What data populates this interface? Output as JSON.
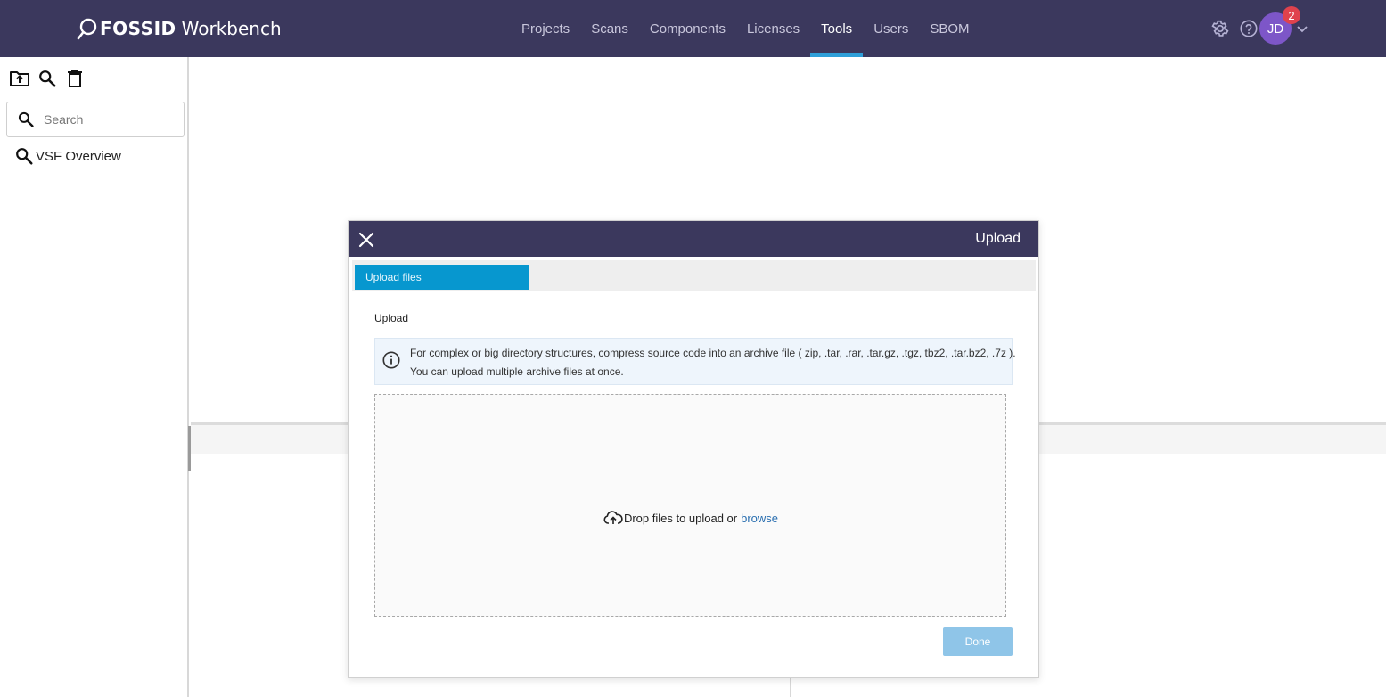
{
  "header": {
    "logo_brand": "FOSSID",
    "logo_product": "Workbench",
    "nav": [
      {
        "label": "Projects",
        "active": false
      },
      {
        "label": "Scans",
        "active": false
      },
      {
        "label": "Components",
        "active": false
      },
      {
        "label": "Licenses",
        "active": false
      },
      {
        "label": "Tools",
        "active": true
      },
      {
        "label": "Users",
        "active": false
      },
      {
        "label": "SBOM",
        "active": false
      }
    ],
    "icons": [
      "gear-icon",
      "help-icon"
    ],
    "user": {
      "initials": "JD",
      "notification_count": "2"
    }
  },
  "sidebar": {
    "tool_icons": [
      "upload-folder-icon",
      "search-icon",
      "trash-icon"
    ],
    "search_placeholder": "Search",
    "items": [
      {
        "label": "VSF Overview",
        "icon": "search-icon"
      }
    ]
  },
  "modal": {
    "title": "Upload",
    "tabs": [
      {
        "label": "Upload files",
        "active": true
      }
    ],
    "section_label": "Upload",
    "info_line1": "For complex or big directory structures, compress source code into an archive file ( zip, .tar, .rar, .tar.gz, .tgz, tbz2, .tar.bz2, .7z ).",
    "info_line2": "You can upload multiple archive files at once.",
    "dropzone_text": "Drop files to upload or",
    "browse_label": "browse",
    "done_label": "Done"
  },
  "colors": {
    "header_bg": "#3b385d",
    "accent": "#2f9fd8",
    "tab_active": "#0797cf",
    "done_disabled": "#8fc5e8",
    "avatar": "#7d56c8",
    "badge": "#e0424d"
  }
}
